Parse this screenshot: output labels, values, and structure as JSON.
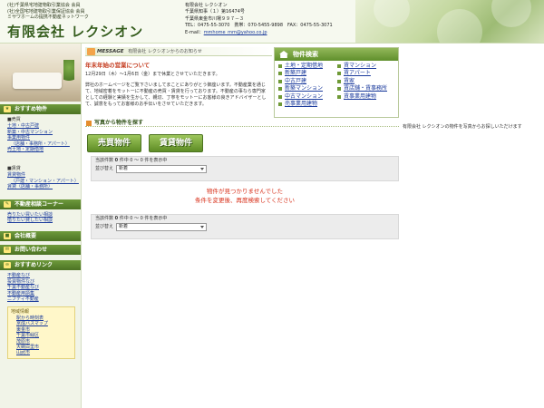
{
  "header": {
    "assoc_lines": [
      "(社)千葉県宅地建物取引業協会 会員",
      "(社)全国宅地建物取引業保証協会 会員",
      "ミサワホームの提携不動産ネットワーク"
    ],
    "logo": "有限会社 レクシオン",
    "contact": {
      "company": "有限会社 レクシオン",
      "license": "千葉県知事（１）第16474号",
      "address": "千葉県東金市川場９９７－３",
      "phone_line": "TEL：0475-55-3070　携帯：070-5455-9898　FAX：0475-55-3071",
      "email_label": "E-mail：",
      "email": "mmhome_mm@yahoo.co.jp"
    }
  },
  "sidebar": {
    "recommend_label": "おすすめ物件",
    "sale_heading": "■売買",
    "sale_links": [
      "土地・中古戸建",
      "新築・中古マンション",
      "事業用物件",
      "（店舗・事務所・アパート）",
      "売土地・定期借地"
    ],
    "rent_heading": "■賃貸",
    "rent_links": [
      "賃貸物件",
      "（戸建・マンション・アパート）",
      "賃貸（店舗・事務所）"
    ],
    "consult_label": "不動産相談コーナー",
    "consult_links": [
      "売りたい買いたい相談",
      "借りたい貸したい相談"
    ],
    "company_label": "会社概要",
    "contact_label": "お問い合わせ",
    "links_label": "おすすめリンク",
    "recommended_links": [
      "不動産なび",
      "投資物件なび",
      "千葉不動産なび",
      "不動産用語集",
      "ニフティ不動産"
    ],
    "area_title": "地域情報",
    "area_items": [
      "駅から時刻表",
      "京成バスマップ",
      "東金市",
      "千葉市緑区",
      "茂原市",
      "大網白里市",
      "山武市"
    ]
  },
  "message": {
    "label": "MESSAGE",
    "sub": "有限会社 レクシオンからのお知らせ",
    "title": "年末年始の営業について",
    "date_line": "12月29日（木）～1月6日（金）まで休業とさせていただきます。",
    "body": "弊社のホームページをご覧下さいましてまことにありがとう御座います。不動産業を通じて、地域密着をモットーに不動産の売買・賃貸を行っております。不動産の事なら専門家としての経験と実績を生かして、親切、丁寧をモットーにお客様の良きアドバイザーとして、誠意をもってお客様のお手伝いをさせていただきます。"
  },
  "search": {
    "title": "物件検索",
    "items": [
      "土地・定期借地",
      "賃マンション",
      "新築戸建",
      "賃アパート",
      "中古戸建",
      "賃家",
      "新築マンション",
      "賃店舗・賃事務所",
      "中古マンション",
      "賃事業用建物",
      "売事業用建物"
    ]
  },
  "photo_search": {
    "title": "写真から物件を探す",
    "note": "有限会社 レクシオンの物件を写真からお探しいただけます",
    "sale_button": "売買物件",
    "rent_button": "賃貸物件"
  },
  "results": {
    "count_label": "当該件数",
    "count": "0",
    "range_text": "件中 0 ～ 0 件を表示中",
    "sort_label": "並び替え",
    "sort_value": "新着",
    "not_found_line1": "物件が見つかりませんでした",
    "not_found_line2": "条件を変更後、再度検索してください"
  },
  "colors": {
    "brand_green": "#5f8f2b",
    "warning_red": "#d8301a"
  }
}
